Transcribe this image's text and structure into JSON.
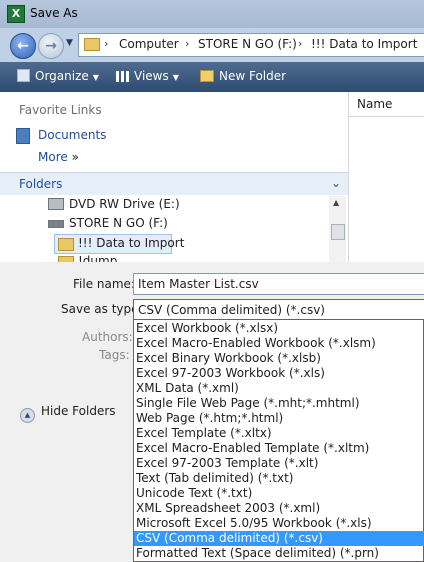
{
  "window": {
    "title": "Save As"
  },
  "address": {
    "crumbs": [
      "Computer",
      "STORE N GO (F:)",
      "!!! Data to Import"
    ]
  },
  "toolbar": {
    "organize": "Organize",
    "views": "Views",
    "new_folder": "New Folder"
  },
  "sidebar": {
    "favorites_header": "Favorite Links",
    "documents": "Documents",
    "more": "More",
    "more_arrow": "»",
    "folders_header": "Folders",
    "tree": [
      "DVD RW Drive (E:)",
      "STORE N GO (F:)",
      "!!! Data to Import",
      "!dump"
    ]
  },
  "file_list": {
    "column_name": "Name"
  },
  "form": {
    "file_name_label": "File name:",
    "file_name_value": "Item Master List.csv",
    "save_type_label": "Save as type:",
    "save_type_value": "CSV (Comma delimited) (*.csv)",
    "authors_label": "Authors:",
    "tags_label": "Tags:",
    "hide_folders": "Hide Folders"
  },
  "save_type_options": [
    "Excel Workbook (*.xlsx)",
    "Excel Macro-Enabled Workbook (*.xlsm)",
    "Excel Binary Workbook (*.xlsb)",
    "Excel 97-2003 Workbook (*.xls)",
    "XML Data (*.xml)",
    "Single File Web Page (*.mht;*.mhtml)",
    "Web Page (*.htm;*.html)",
    "Excel Template (*.xltx)",
    "Excel Macro-Enabled Template (*.xltm)",
    "Excel 97-2003 Template (*.xlt)",
    "Text (Tab delimited) (*.txt)",
    "Unicode Text (*.txt)",
    "XML Spreadsheet 2003 (*.xml)",
    "Microsoft Excel 5.0/95 Workbook (*.xls)",
    "CSV (Comma delimited) (*.csv)",
    "Formatted Text (Space delimited) (*.prn)"
  ],
  "selected_option_index": 14,
  "colors": {
    "selection": "#3399ff",
    "toolbar": "#2d4a70",
    "link": "#1e4e9c"
  }
}
